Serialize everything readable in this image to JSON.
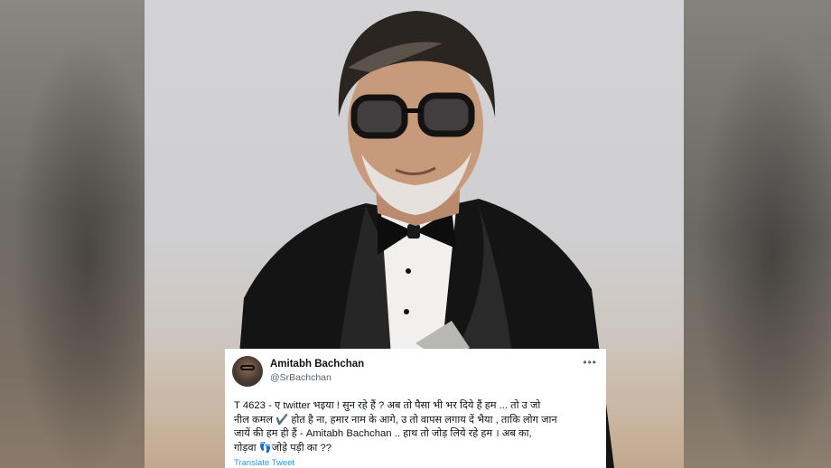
{
  "tweet": {
    "display_name": "Amitabh Bachchan",
    "handle": "@SrBachchan",
    "more_icon": "more-horizontal-icon",
    "text_line1": "T 4623 - ए twitter भइया ! सुन रहे हैं ? अब तो पैसा भी भर दिये हैं हम ...  तो उ जो",
    "text_line2": "नील कमल ✔️ होत है ना, हमार नाम के आगे, उ  तो वापस लगाय दें भैया  , ताकि लोग जान",
    "text_line3": "जायें की हम ही हैं  - Amitabh Bachchan .. हाथ तो जोड़ लिये रहे हम  ।  अब का,",
    "text_line4": "गोड़वा 👣जोड़े पड़ी  का ??",
    "translate_label": "Translate Tweet"
  },
  "colors": {
    "link": "#1d9bf0",
    "muted": "#536471",
    "text": "#0f1419"
  }
}
